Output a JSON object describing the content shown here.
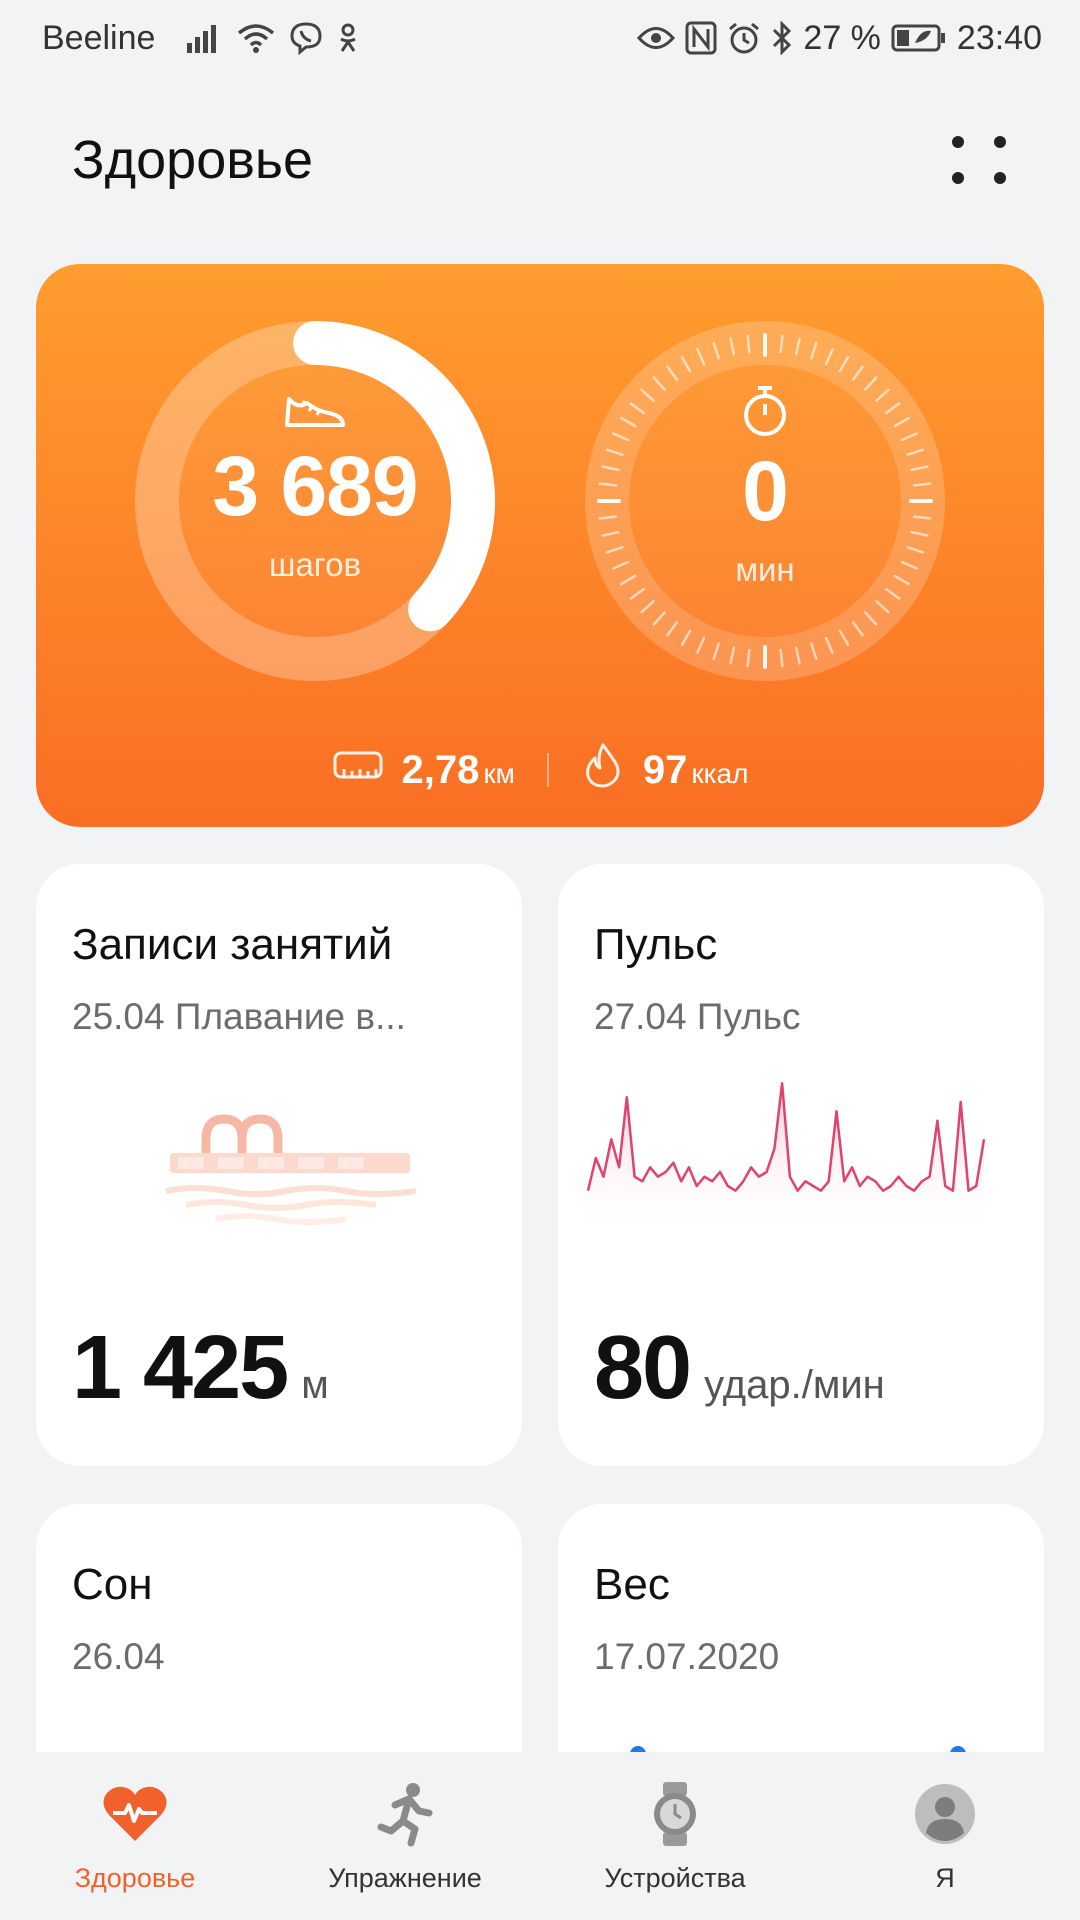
{
  "status_bar": {
    "carrier": "Beeline",
    "battery": "27 %",
    "time": "23:40",
    "icons": [
      "signal-icon",
      "wifi-icon",
      "viber-icon",
      "ok-icon",
      "eye-icon",
      "nfc-icon",
      "alarm-icon",
      "bluetooth-icon",
      "battery-icon"
    ]
  },
  "header": {
    "title": "Здоровье"
  },
  "activity": {
    "steps_value": "3 689",
    "steps_unit": "шагов",
    "steps_progress": 0.37,
    "minutes_value": "0",
    "minutes_unit": "мин",
    "distance_value": "2,78",
    "distance_unit": "км",
    "calories_value": "97",
    "calories_unit": "ккал",
    "accent_top": "#ff9d2e",
    "accent_bottom": "#fa6e24"
  },
  "tiles": {
    "workouts": {
      "title": "Записи занятий",
      "subtitle": "25.04 Плавание в...",
      "value": "1 425",
      "unit": "м"
    },
    "pulse": {
      "title": "Пульс",
      "subtitle": "27.04 Пульс",
      "value": "80",
      "unit": "удар./мин"
    },
    "sleep": {
      "title": "Сон",
      "subtitle": "26.04"
    },
    "weight": {
      "title": "Вес",
      "subtitle": "17.07.2020"
    }
  },
  "pulse_chart": {
    "type": "line",
    "values": [
      55,
      62,
      58,
      66,
      60,
      75,
      58,
      57,
      60,
      58,
      59,
      61,
      57,
      60,
      56,
      58,
      57,
      59,
      56,
      55,
      57,
      60,
      58,
      59,
      64,
      78,
      58,
      55,
      57,
      56,
      55,
      57,
      72,
      57,
      60,
      56,
      58,
      57,
      55,
      56,
      58,
      56,
      55,
      57,
      58,
      70,
      56,
      55,
      74,
      55,
      56,
      66
    ]
  },
  "bottom_nav": [
    {
      "label": "Здоровье",
      "icon": "heart-pulse-icon",
      "active": true
    },
    {
      "label": "Упражнение",
      "icon": "runner-icon",
      "active": false
    },
    {
      "label": "Устройства",
      "icon": "watch-icon",
      "active": false
    },
    {
      "label": "Я",
      "icon": "profile-icon",
      "active": false
    }
  ],
  "colors": {
    "active_nav": "#f0612b",
    "pulse_line": "#e0436b"
  }
}
